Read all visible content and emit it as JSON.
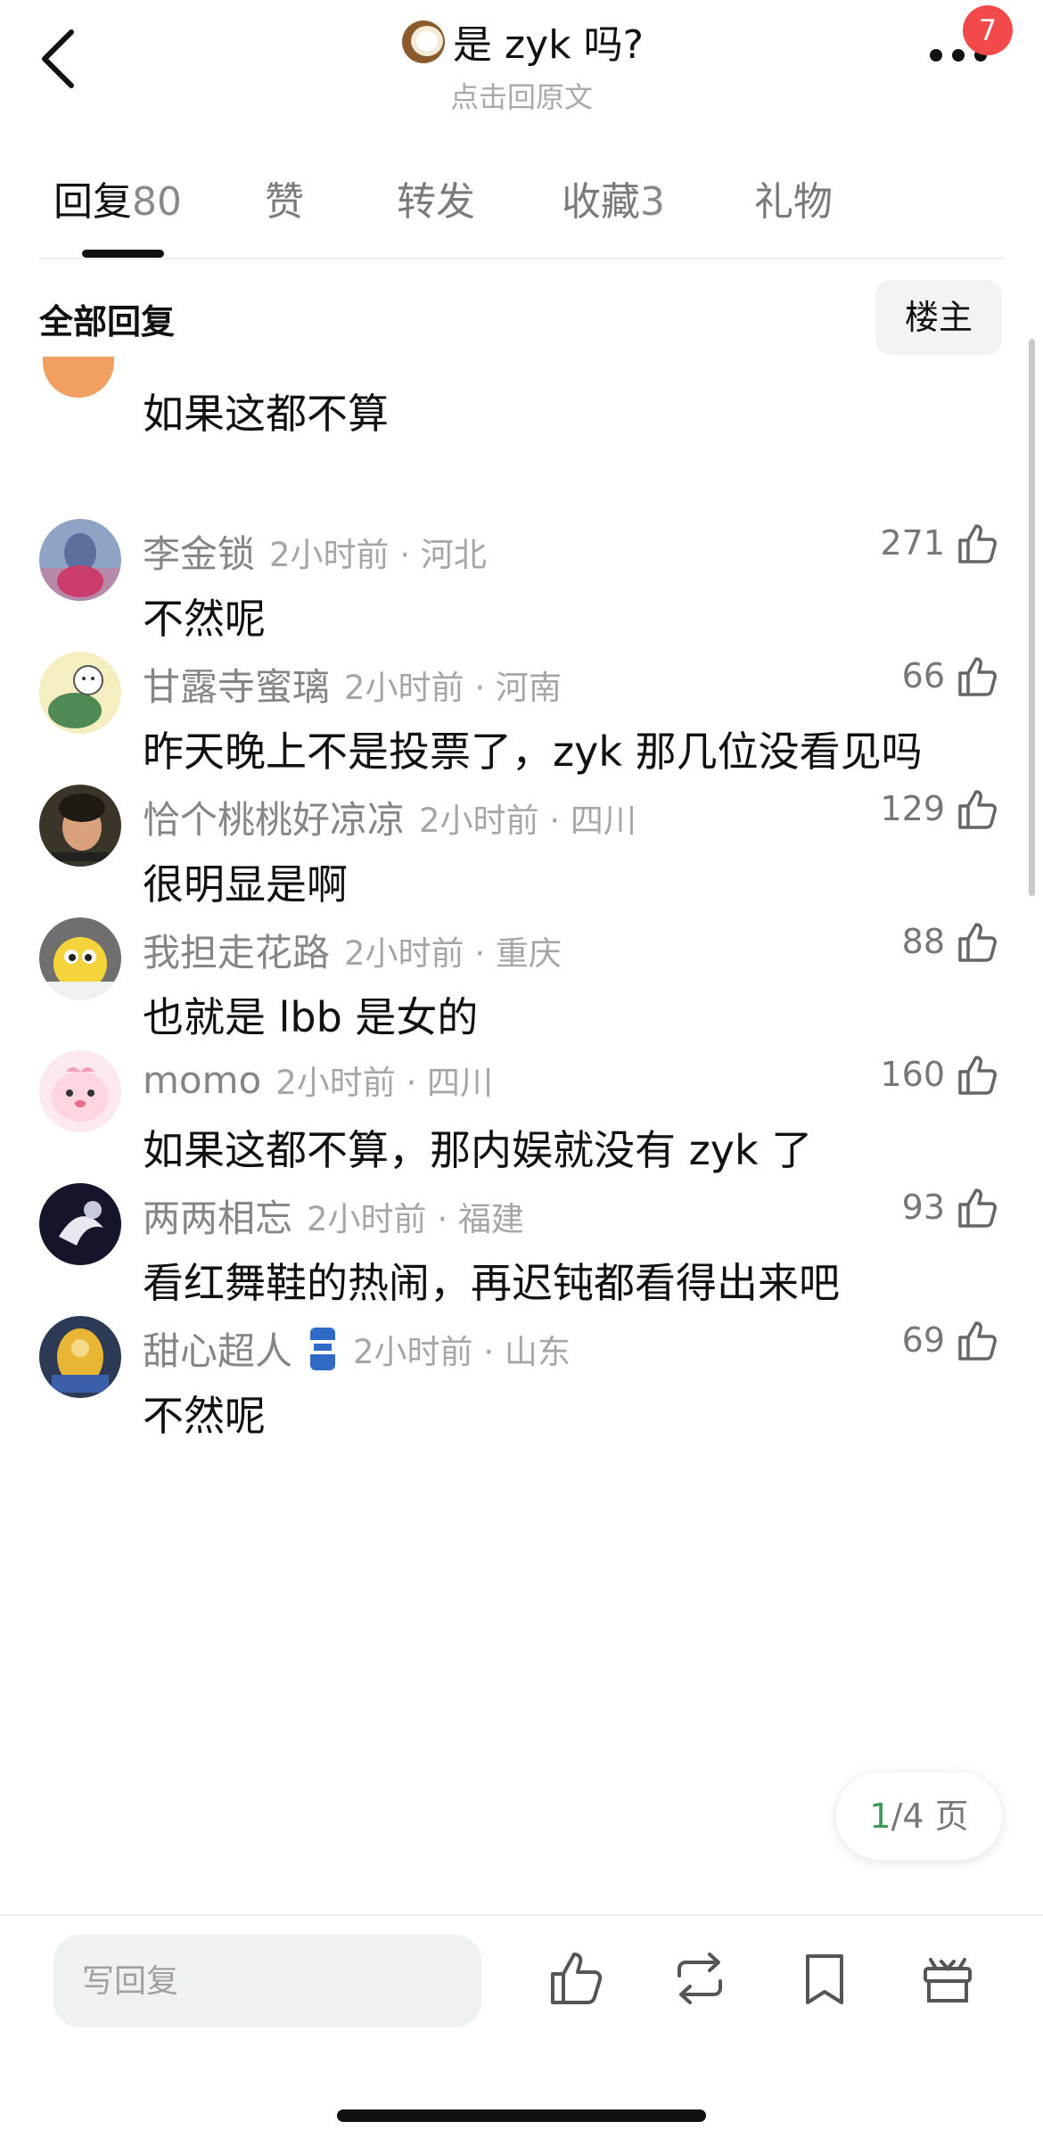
{
  "header": {
    "title": "是 zyk 吗?",
    "subtitle": "点击回原文",
    "badge_count": "7",
    "icons": {
      "back": "chevron-left-icon",
      "title_emoji": "coconut-icon",
      "more": "more-dots-icon"
    }
  },
  "tabs": [
    {
      "label": "回复",
      "count": "80",
      "active": true
    },
    {
      "label": "赞",
      "count": "",
      "active": false
    },
    {
      "label": "转发",
      "count": "",
      "active": false
    },
    {
      "label": "收藏",
      "count": "3",
      "active": false
    },
    {
      "label": "礼物",
      "count": "",
      "active": false
    }
  ],
  "section": {
    "title": "全部回复",
    "filter_button": "楼主"
  },
  "partial_comment": {
    "content": "如果这都不算"
  },
  "comments": [
    {
      "username": "李金锁",
      "time_location": "2小时前 · 河北",
      "content": "不然呢",
      "likes": "271"
    },
    {
      "username": "甘露寺蜜璃",
      "time_location": "2小时前 · 河南",
      "content": "昨天晚上不是投票了，zyk 那几位没看见吗",
      "likes": "66"
    },
    {
      "username": "恰个桃桃好凉凉",
      "time_location": "2小时前 · 四川",
      "content": "很明显是啊",
      "likes": "129"
    },
    {
      "username": "我担走花路",
      "time_location": "2小时前 · 重庆",
      "content": "也就是 lbb 是女的",
      "likes": "88"
    },
    {
      "username": "momo",
      "time_location": "2小时前 · 四川",
      "content": "如果这都不算，那内娱就没有 zyk 了",
      "likes": "160"
    },
    {
      "username": "两两相忘",
      "time_location": "2小时前 · 福建",
      "content": "看红舞鞋的热闹，再迟钝都看得出来吧",
      "likes": "93"
    },
    {
      "username": "甜心超人",
      "time_location": "2小时前 · 山东",
      "content": "不然呢",
      "likes": "69",
      "badge_icon": "beer-can-icon"
    }
  ],
  "pagination": {
    "current": "1",
    "total": "/4 页"
  },
  "bottom_bar": {
    "reply_placeholder": "写回复",
    "icons": [
      "thumbs-up-icon",
      "repost-icon",
      "bookmark-icon",
      "gift-icon"
    ]
  },
  "colors": {
    "badge": "#f2494b",
    "page_current": "#3f9a5a",
    "reply_bg": "#eef3ef"
  }
}
